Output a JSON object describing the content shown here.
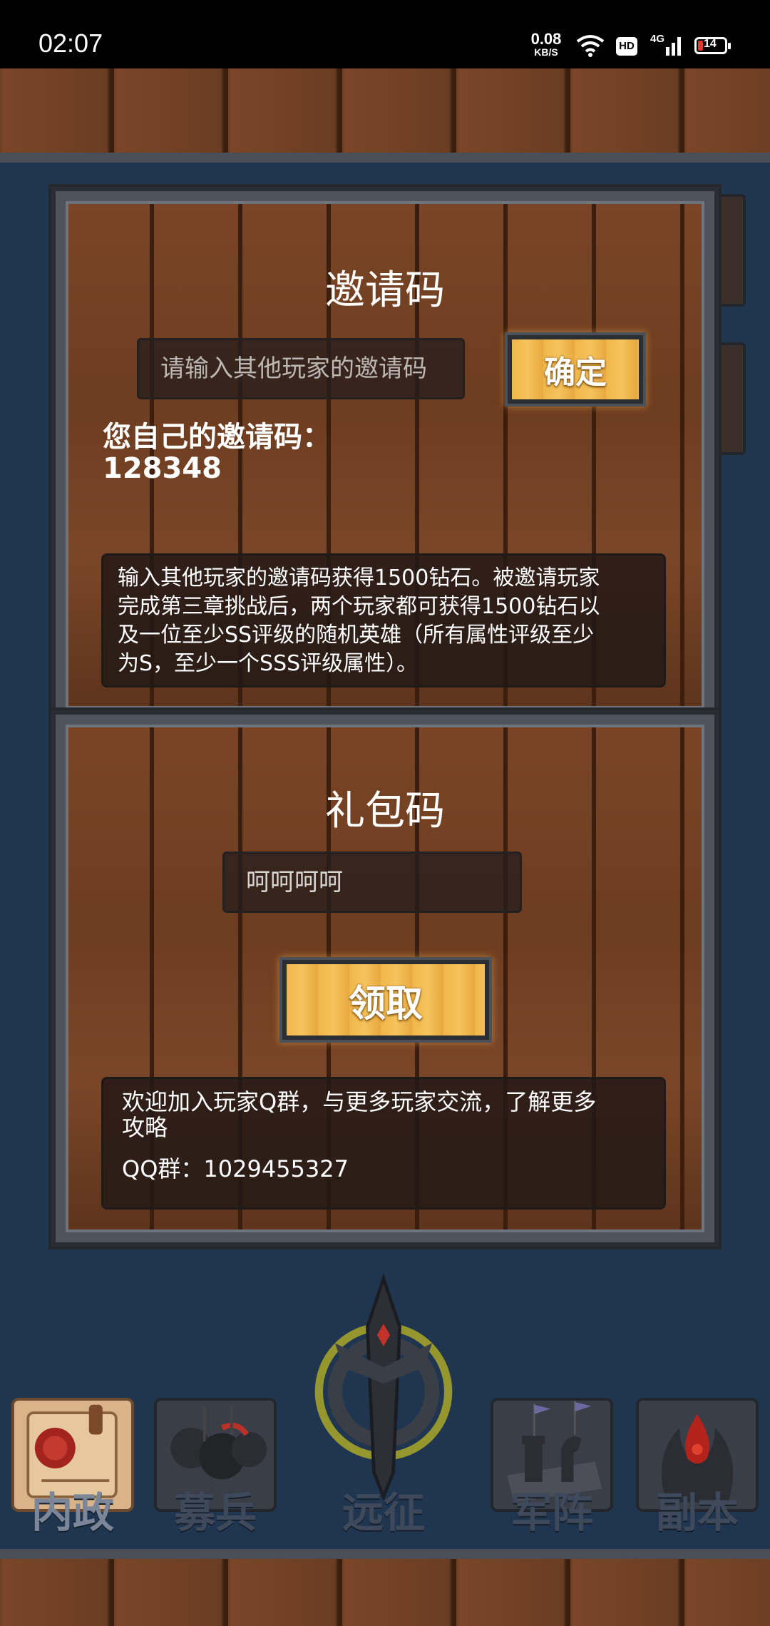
{
  "status_bar": {
    "time": "02:07",
    "net_speed_value": "0.08",
    "net_speed_unit": "KB/S",
    "hd_badge": "HD",
    "signal_label": "4G",
    "battery_level": "14"
  },
  "invite_panel": {
    "title": "邀请码",
    "input_placeholder": "请输入其他玩家的邀请码",
    "confirm_button": "确定",
    "own_code_label": "您自己的邀请码：",
    "own_code_value": "128348",
    "info_line1": "输入其他玩家的邀请码获得1500钻石。被邀请玩家",
    "info_line2": "完成第三章挑战后，两个玩家都可获得1500钻石以",
    "info_line3": "及一位至少SS评级的随机英雄（所有属性评级至少",
    "info_line4": "为S，至少一个SSS评级属性）。"
  },
  "gift_panel": {
    "title": "礼包码",
    "input_value": "呵呵呵呵",
    "claim_button": "领取",
    "info_line1": "欢迎加入玩家Q群，与更多玩家交流，了解更多",
    "info_line2": "攻略",
    "qq_group": "QQ群：1029455327"
  },
  "bottom_nav": {
    "items": [
      {
        "label": "内政",
        "icon": "scroll-seal-icon"
      },
      {
        "label": "募兵",
        "icon": "knights-icon"
      },
      {
        "label": "远征",
        "icon": "sword-emblem-icon"
      },
      {
        "label": "军阵",
        "icon": "chess-icon"
      },
      {
        "label": "副本",
        "icon": "flame-dungeon-icon"
      }
    ],
    "active_index": 0
  },
  "colors": {
    "wood": "#6d3d20",
    "frame": "#4e535c",
    "button_gold": "#f0b64a",
    "background": "#1f3550"
  }
}
